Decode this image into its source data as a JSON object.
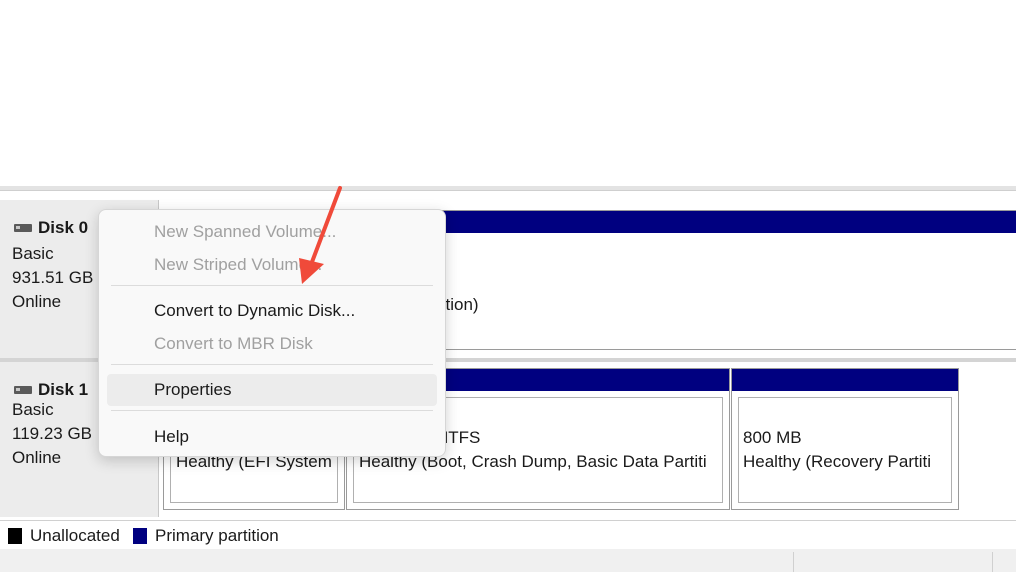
{
  "disks": [
    {
      "name": "Disk 0",
      "type": "Basic",
      "size": "931.51 GB",
      "status": "Online"
    },
    {
      "name": "Disk 1",
      "type": "Basic",
      "size": "119.23 GB",
      "status": "Online"
    }
  ],
  "disk0_partition": {
    "visible_text": "tition)"
  },
  "disk1_partitions": [
    {
      "line2": "Healthy (EFI System"
    },
    {
      "line1": "NTFS",
      "line2": "Healthy (Boot, Crash Dump, Basic Data Partiti"
    },
    {
      "line1": "800 MB",
      "line2": "Healthy (Recovery Partiti"
    }
  ],
  "context_menu": {
    "items": [
      {
        "label": "New Spanned Volume...",
        "disabled": true
      },
      {
        "label": "New Striped Volume...",
        "disabled": true
      },
      {
        "label": "Convert to Dynamic Disk...",
        "disabled": false
      },
      {
        "label": "Convert to MBR Disk",
        "disabled": true
      },
      {
        "label": "Properties",
        "disabled": false
      },
      {
        "label": "Help",
        "disabled": false
      }
    ]
  },
  "legend": {
    "unallocated": "Unallocated",
    "primary": "Primary partition"
  },
  "colors": {
    "primary_partition": "#000080",
    "unallocated": "#000000",
    "annotation_arrow": "#f04a3a"
  }
}
